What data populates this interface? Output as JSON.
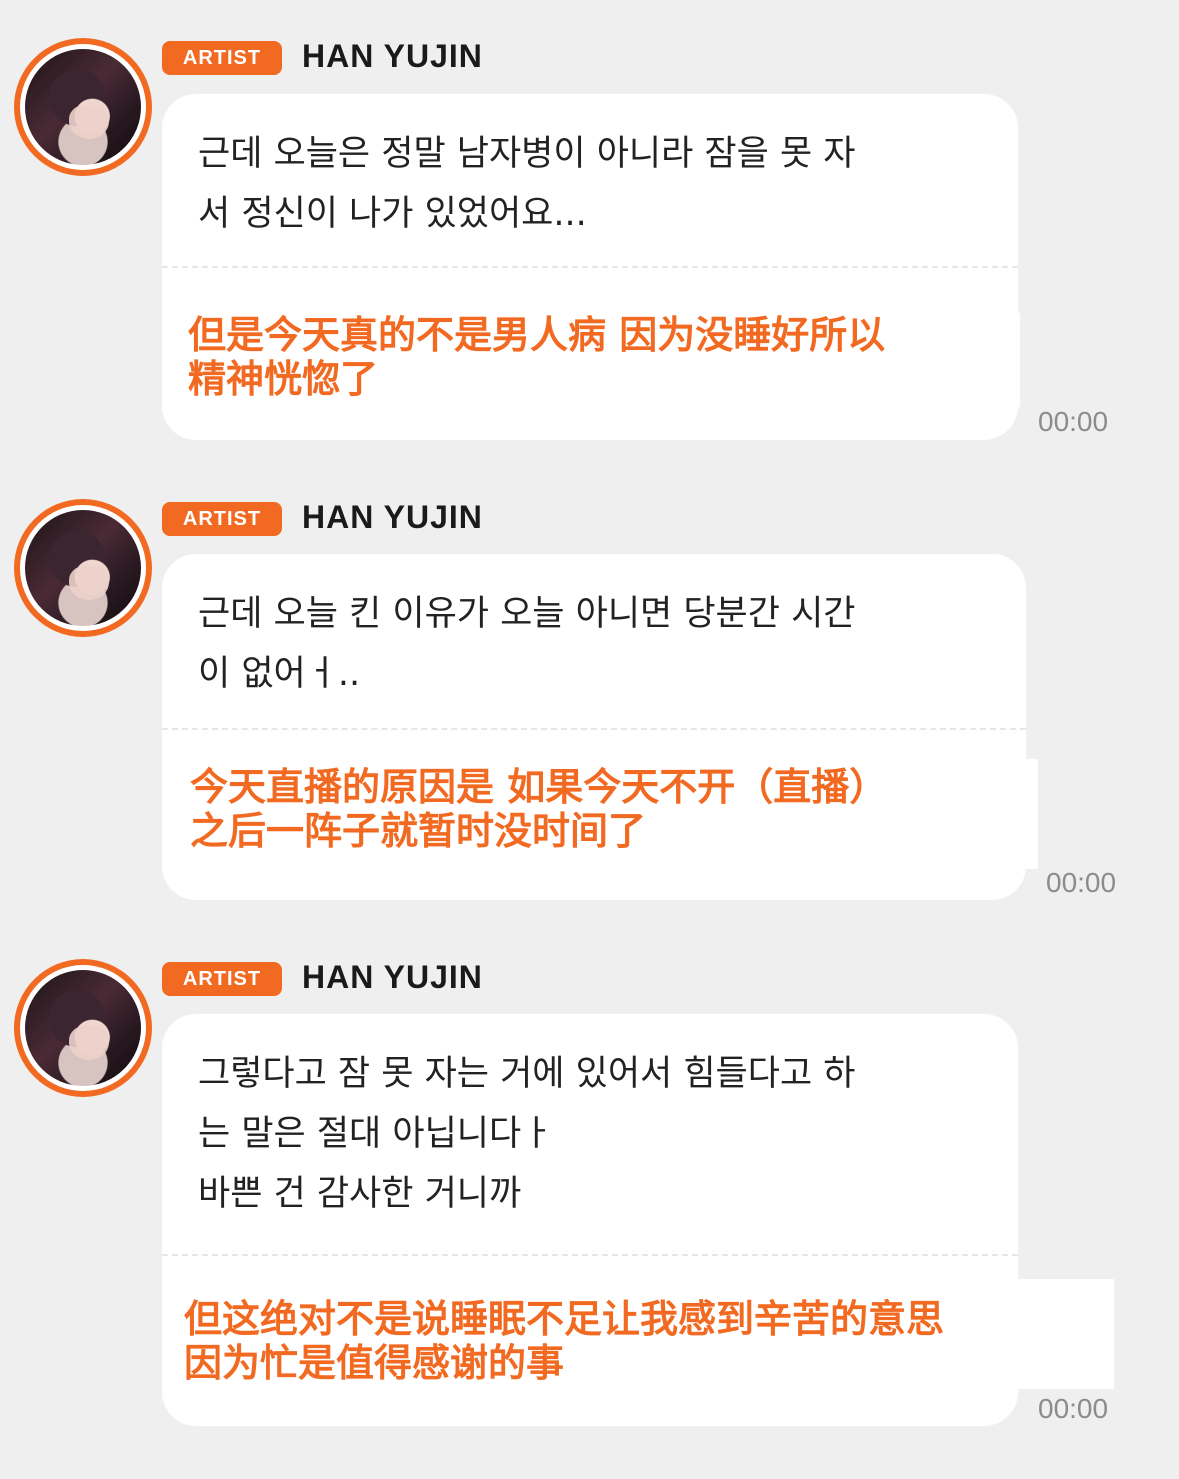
{
  "messages": [
    {
      "badge": "ARTIST",
      "username": "HAN YUJIN",
      "korean": "근데 오늘은 정말 남자병이 아니라 잠을 못 자\n서 정신이 나가 있었어요...",
      "translation": "但是今天真的不是男人病 因为没睡好所以\n精神恍惚了",
      "time": "00:00"
    },
    {
      "badge": "ARTIST",
      "username": "HAN YUJIN",
      "korean": "근데 오늘 킨 이유가 오늘 아니면 당분간 시간\n이 없어ㅓ..",
      "translation": "今天直播的原因是 如果今天不开（直播）\n之后一阵子就暂时没时间了",
      "time": "00:00"
    },
    {
      "badge": "ARTIST",
      "username": "HAN YUJIN",
      "korean": "그렇다고 잠 못 자는 거에 있어서 힘들다고 하\n는 말은 절대 아닙니다ㅏ\n바쁜 건 감사한 거니까",
      "translation": "但这绝对不是说睡眠不足让我感到辛苦的意思\n因为忙是值得感谢的事",
      "time": "00:00"
    }
  ]
}
